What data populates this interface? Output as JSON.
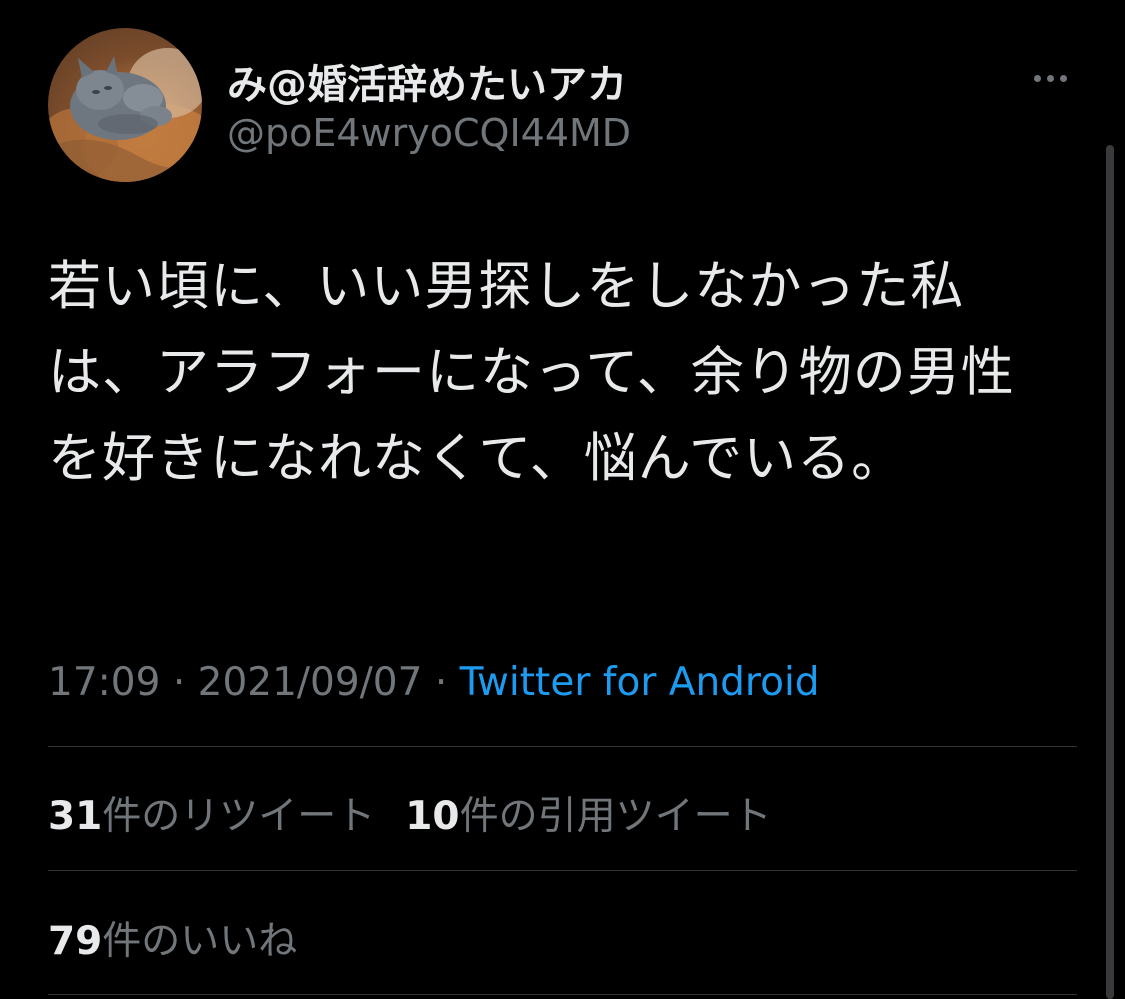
{
  "user": {
    "display_name": "み@婚活辞めたいアカ",
    "handle": "@poE4wryoCQI44MD"
  },
  "tweet": {
    "text": "若い頃に、いい男探しをしなかった私は、アラフォーになって、余り物の男性を好きになれなくて、悩んでいる。",
    "time": "17:09",
    "separator": "·",
    "date": "2021/09/07",
    "source": "Twitter for Android"
  },
  "stats": {
    "retweets_count": "31",
    "retweets_label": "件のリツイート",
    "quotes_count": "10",
    "quotes_label": "件の引用ツイート",
    "likes_count": "79",
    "likes_label": "件のいいね"
  },
  "icons": {
    "more": "more-horizontal-icon",
    "avatar": "cat-photo-avatar"
  },
  "colors": {
    "background": "#000000",
    "primary_text": "#e7e9ea",
    "secondary_text": "#71767b",
    "link": "#1d9bf0",
    "divider": "#2f3336"
  }
}
